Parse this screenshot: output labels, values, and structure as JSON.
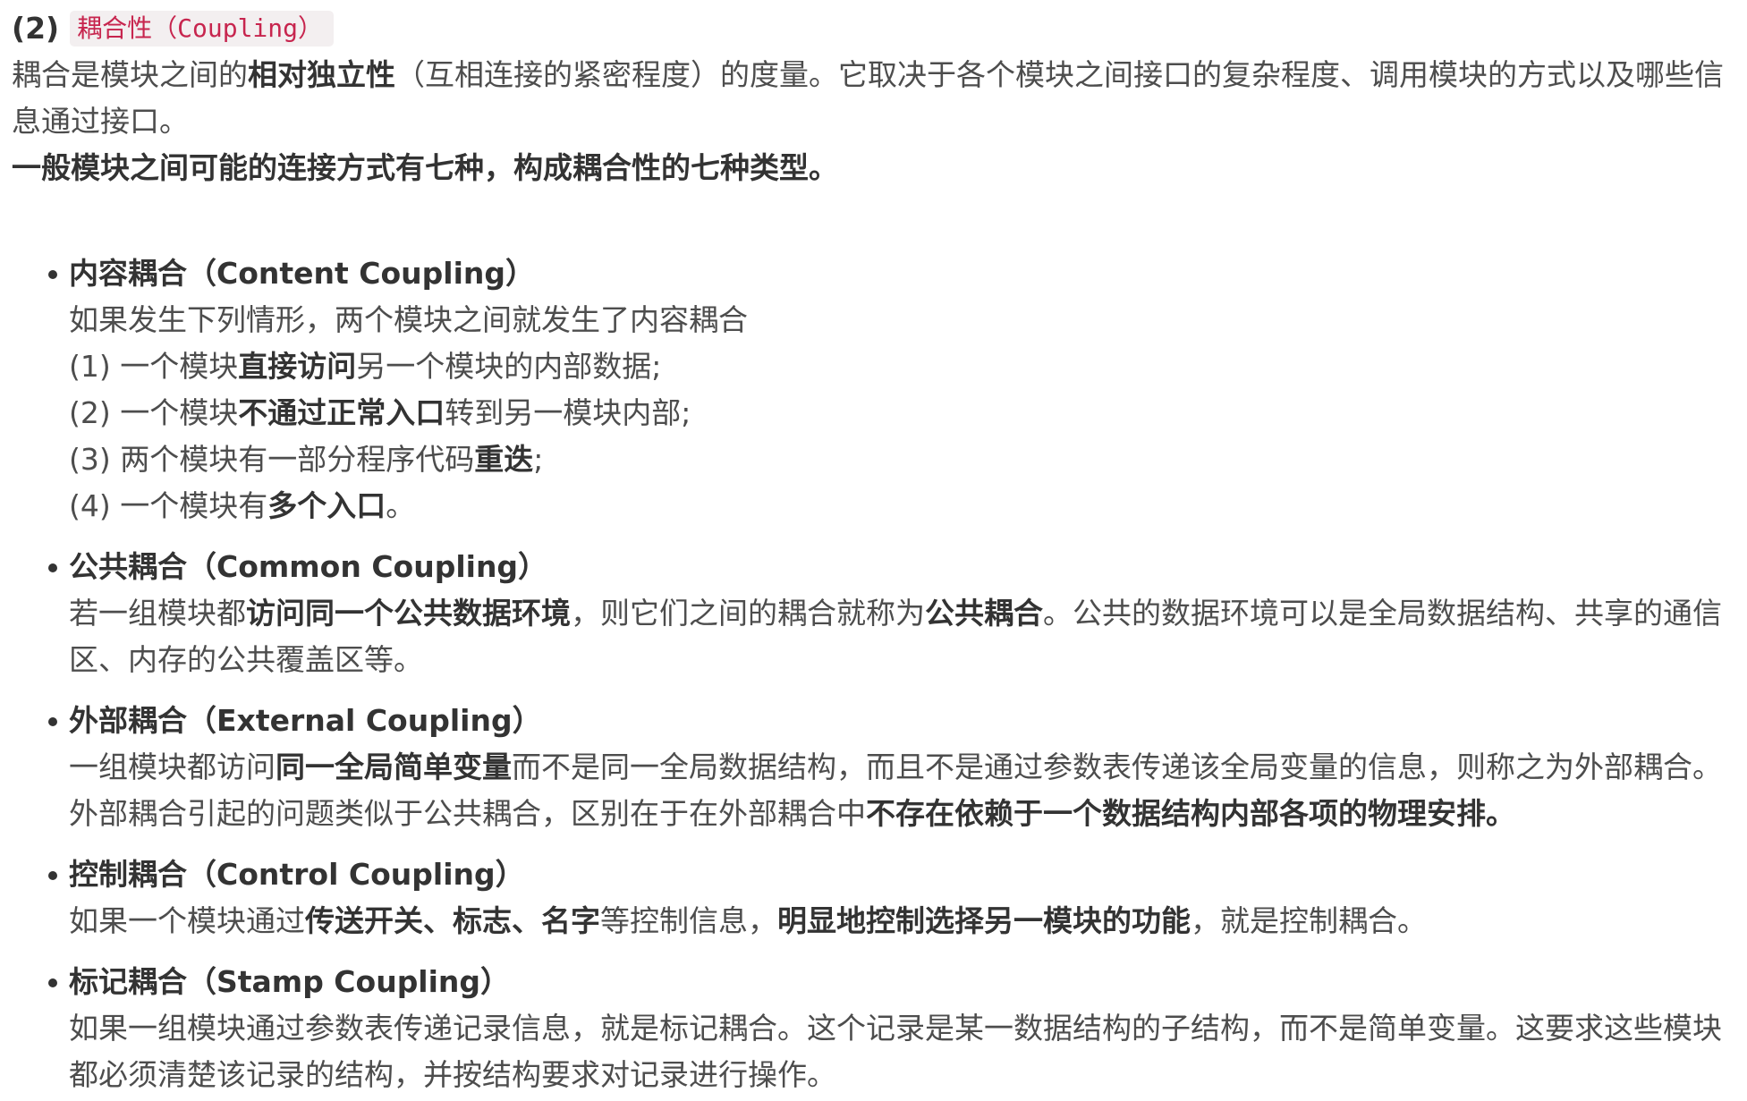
{
  "section": {
    "number": "(2)",
    "code": "耦合性（Coupling）"
  },
  "intro": [
    [
      {
        "t": "耦合是模块之间的"
      },
      {
        "t": "相对独立性",
        "b": true
      },
      {
        "t": "（互相连接的紧密程度）的度量。它取决于各个模块之间接口的复杂程度、调用模块的方式以及哪些信息通过接口。"
      }
    ],
    [
      {
        "t": "一般模块之间可能的连接方式有七种，构成耦合性的七种类型。",
        "b": true
      }
    ]
  ],
  "items": [
    {
      "title": "内容耦合（Content Coupling）",
      "lines": [
        [
          {
            "t": "如果发生下列情形，两个模块之间就发生了内容耦合"
          }
        ],
        [
          {
            "t": "(1) 一个模块"
          },
          {
            "t": "直接访问",
            "b": true
          },
          {
            "t": "另一个模块的内部数据;"
          }
        ],
        [
          {
            "t": "(2) 一个模块"
          },
          {
            "t": "不通过正常入口",
            "b": true
          },
          {
            "t": "转到另一模块内部;"
          }
        ],
        [
          {
            "t": "(3) 两个模块有一部分程序代码"
          },
          {
            "t": "重迭",
            "b": true
          },
          {
            "t": ";"
          }
        ],
        [
          {
            "t": "(4) 一个模块有"
          },
          {
            "t": "多个入口",
            "b": true
          },
          {
            "t": "。"
          }
        ]
      ]
    },
    {
      "title": "公共耦合（Common Coupling）",
      "lines": [
        [
          {
            "t": "若一组模块都"
          },
          {
            "t": "访问同一个公共数据环境",
            "b": true
          },
          {
            "t": "，则它们之间的耦合就称为"
          },
          {
            "t": "公共耦合",
            "b": true
          },
          {
            "t": "。公共的数据环境可以是全局数据结构、共享的通信区、内存的公共覆盖区等。"
          }
        ]
      ]
    },
    {
      "title": "外部耦合（External Coupling）",
      "lines": [
        [
          {
            "t": "一组模块都访问"
          },
          {
            "t": "同一全局简单变量",
            "b": true
          },
          {
            "t": "而不是同一全局数据结构，而且不是通过参数表传递该全局变量的信息，则称之为外部耦合。"
          }
        ],
        [
          {
            "t": "外部耦合引起的问题类似于公共耦合，区别在于在外部耦合中"
          },
          {
            "t": "不存在依赖于一个数据结构内部各项的物理安排。",
            "b": true
          }
        ]
      ]
    },
    {
      "title": "控制耦合（Control Coupling）",
      "lines": [
        [
          {
            "t": "如果一个模块通过"
          },
          {
            "t": "传送开关、标志、名字",
            "b": true
          },
          {
            "t": "等控制信息，"
          },
          {
            "t": "明显地控制选择另一模块的功能",
            "b": true
          },
          {
            "t": "，就是控制耦合。"
          }
        ]
      ]
    },
    {
      "title": "标记耦合（Stamp Coupling）",
      "lines": [
        [
          {
            "t": "如果一组模块通过参数表传递记录信息，就是标记耦合。这个记录是某一数据结构的子结构，而不是简单变量。这要求这些模块都必须清楚该记录的结构，并按结构要求对记录进行操作。"
          }
        ]
      ]
    }
  ]
}
